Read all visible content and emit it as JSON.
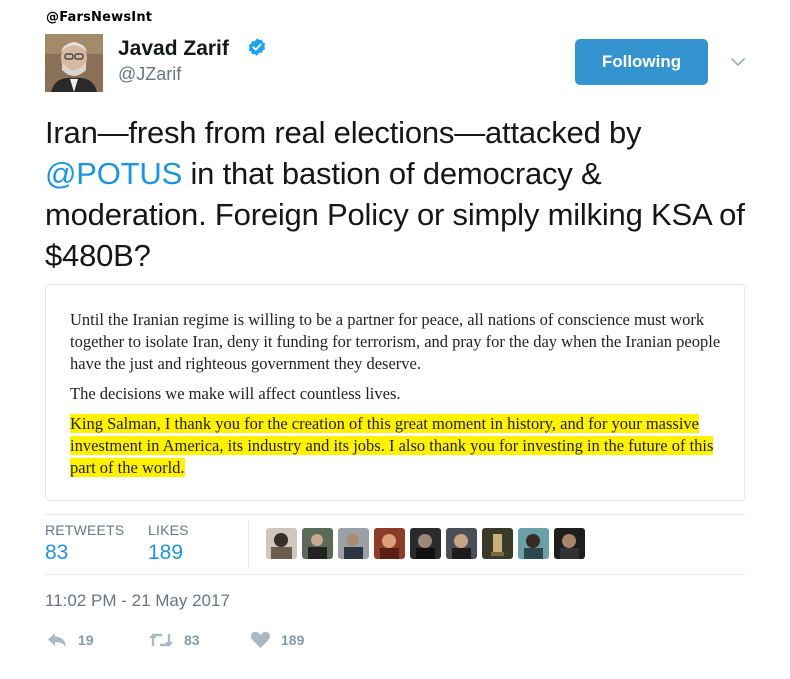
{
  "watermark": "@FarsNewsInt",
  "author": {
    "name": "Javad Zarif",
    "handle": "@JZarif"
  },
  "follow_button": "Following",
  "tweet": {
    "text_before": "Iran—fresh from real elections—attacked by ",
    "mention": "@POTUS",
    "text_after": " in that bastion of democracy & moderation. Foreign Policy or simply milking KSA of $480B?"
  },
  "attached_image": {
    "paragraph_1": "Until the Iranian regime is willing to be a partner for peace, all nations of conscience must work together to isolate Iran, deny it funding for terrorism, and pray for the day when the Iranian people have the just and righteous government they deserve.",
    "paragraph_2": "The decisions we make will affect countless lives.",
    "paragraph_3_highlighted": "King Salman, I thank you for the creation of this great moment in history, and for your massive investment in America, its industry and its jobs. I also thank you for investing in the future of this part of the world."
  },
  "stats": {
    "retweets_label": "RETWEETS",
    "retweets_value": "83",
    "likes_label": "LIKES",
    "likes_value": "189"
  },
  "timestamp": "11:02 PM - 21 May 2017",
  "actions": {
    "reply_count": "19",
    "retweet_count": "83",
    "like_count": "189"
  },
  "colors": {
    "accent": "#1b95e0",
    "follow_button": "#3394cf",
    "muted": "#657786",
    "highlight": "#fff200"
  }
}
